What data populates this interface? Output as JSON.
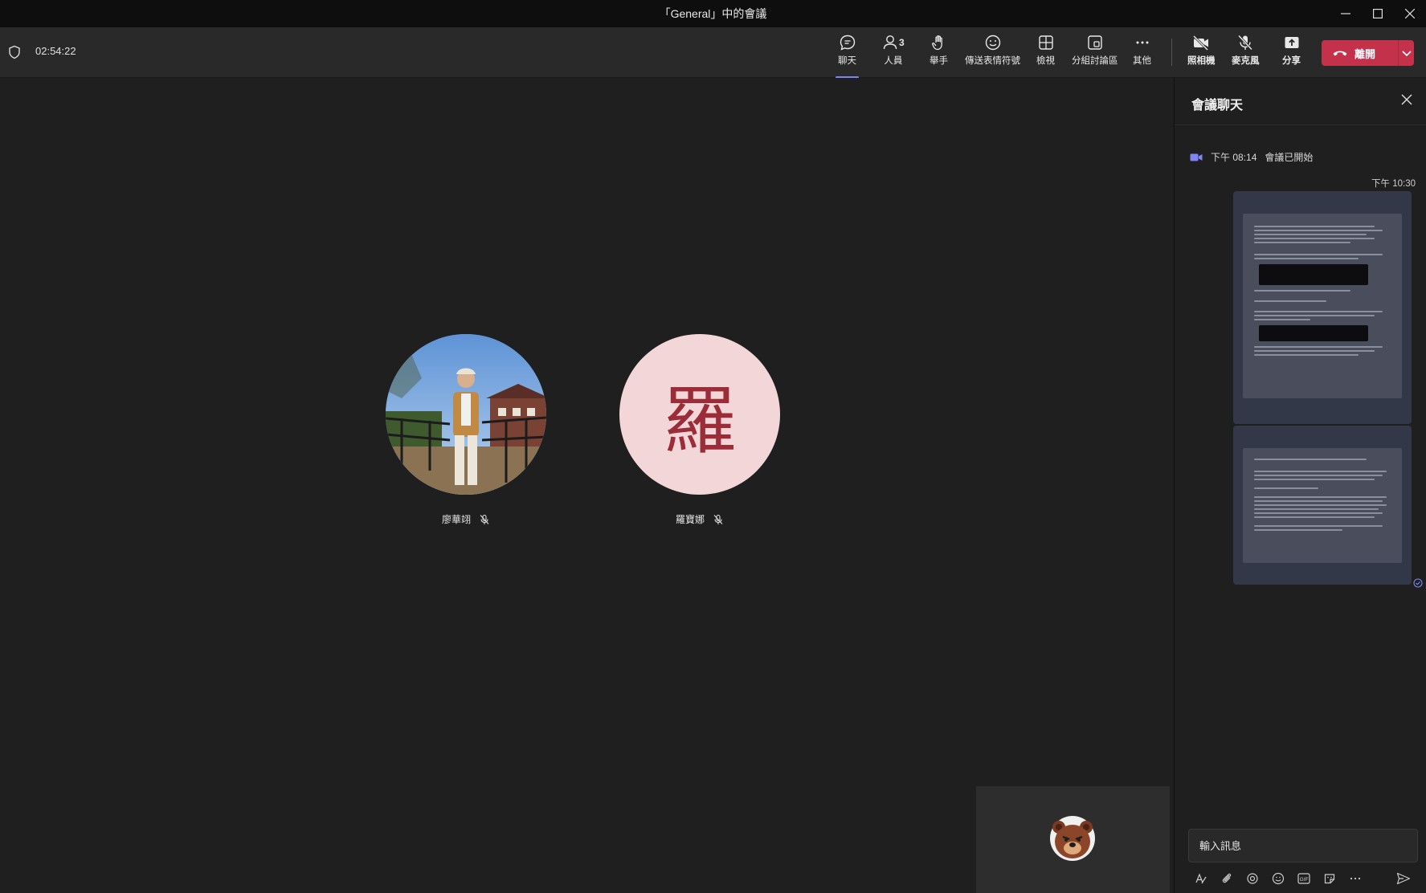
{
  "window": {
    "title": "「General」中的會議"
  },
  "toolbar": {
    "timer": "02:54:22",
    "buttons": {
      "chat": "聊天",
      "people": "人員",
      "people_count": "3",
      "raise_hand": "舉手",
      "reactions": "傳送表情符號",
      "view": "檢視",
      "breakout": "分組討論區",
      "more": "其他",
      "camera": "照相機",
      "mic": "麥克風",
      "share": "分享"
    },
    "leave_label": "離開",
    "accent_color": "#7f85f5",
    "leave_color": "#c4314b"
  },
  "participants": [
    {
      "name": "廖華翊",
      "avatar": "photo",
      "muted": true
    },
    {
      "name": "羅寶娜",
      "avatar_initial": "羅",
      "muted": true
    }
  ],
  "chat": {
    "title": "會議聊天",
    "system_time": "下午 08:14",
    "system_text": "會議已開始",
    "message_time": "下午 10:30",
    "compose_placeholder": "輸入訊息"
  }
}
